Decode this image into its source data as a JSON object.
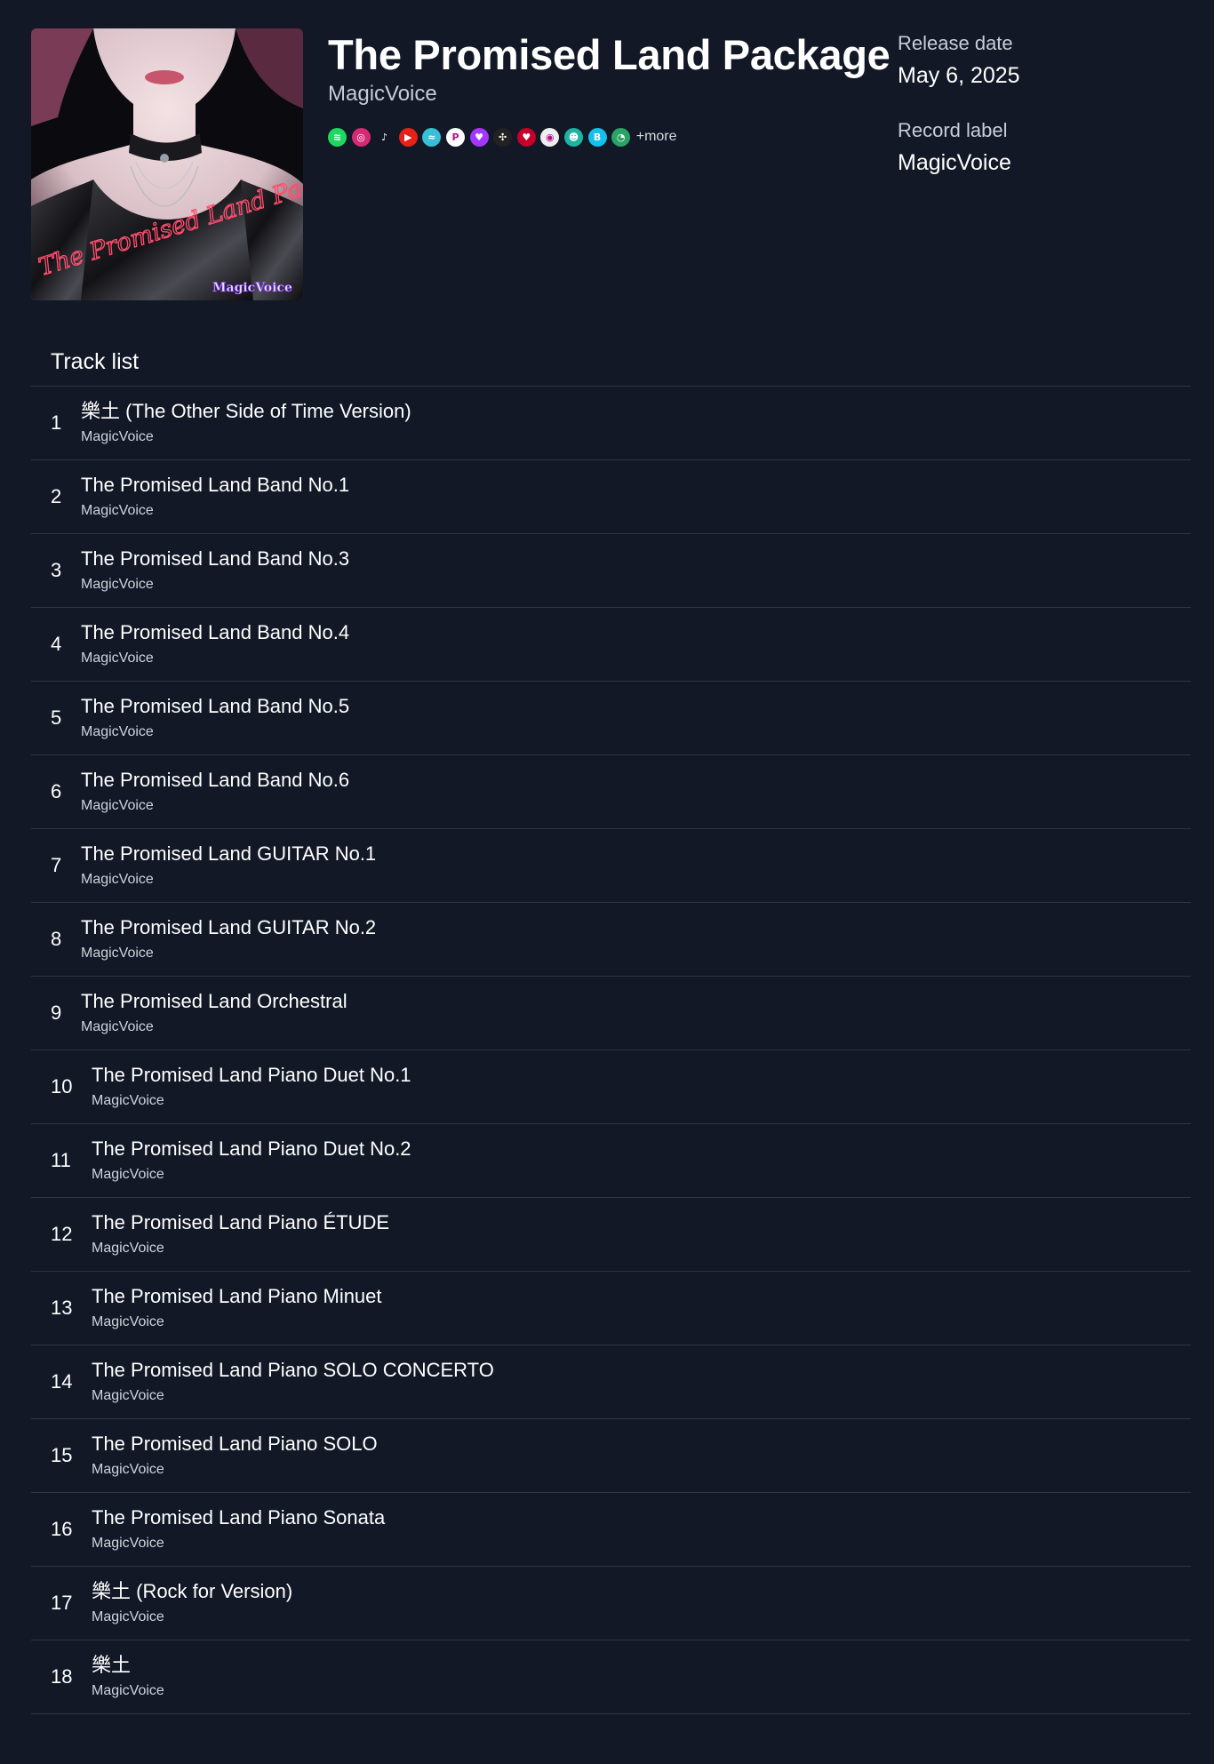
{
  "album": {
    "title": "The Promised Land Package",
    "artist": "MagicVoice",
    "cover_text_main": "The Promised Land Package",
    "cover_text_brand": "MagicVoice"
  },
  "platforms": [
    {
      "icon": "spotify-icon",
      "color": "#1ed760",
      "glyph": "≋"
    },
    {
      "icon": "instagram-icon",
      "color": "#d62976",
      "glyph": "◎"
    },
    {
      "icon": "tiktok-icon",
      "color": "#121826",
      "glyph": "♪"
    },
    {
      "icon": "youtube-music-icon",
      "color": "#e62117",
      "glyph": "▶"
    },
    {
      "icon": "amazon-music-icon",
      "color": "#38c0d8",
      "glyph": "≈"
    },
    {
      "icon": "pandora-icon",
      "color": "#ffffff",
      "glyph": "P"
    },
    {
      "icon": "deezer-icon",
      "color": "#a238ff",
      "glyph": "♥"
    },
    {
      "icon": "tidal-icon",
      "color": "#222222",
      "glyph": "✣"
    },
    {
      "icon": "iheartradio-icon",
      "color": "#c6002b",
      "glyph": "♥"
    },
    {
      "icon": "audiomack-icon",
      "color": "#eeeeee",
      "glyph": "◉"
    },
    {
      "icon": "anghami-icon",
      "color": "#1db4a4",
      "glyph": "☻"
    },
    {
      "icon": "boomplay-icon",
      "color": "#12c2e9",
      "glyph": "B"
    },
    {
      "icon": "qobuz-icon",
      "color": "#29a366",
      "glyph": "◔"
    }
  ],
  "platforms_more": "+more",
  "meta": {
    "release_label": "Release date",
    "release_value": "May 6, 2025",
    "label_label": "Record label",
    "label_value": "MagicVoice"
  },
  "tracklist": {
    "heading": "Track list",
    "tracks": [
      {
        "num": "1",
        "name": "樂土 (The Other Side of Time Version)",
        "artist": "MagicVoice"
      },
      {
        "num": "2",
        "name": "The Promised Land Band No.1",
        "artist": "MagicVoice"
      },
      {
        "num": "3",
        "name": "The Promised Land Band No.3",
        "artist": "MagicVoice"
      },
      {
        "num": "4",
        "name": "The Promised Land Band No.4",
        "artist": "MagicVoice"
      },
      {
        "num": "5",
        "name": "The Promised Land Band No.5",
        "artist": "MagicVoice"
      },
      {
        "num": "6",
        "name": "The Promised Land Band No.6",
        "artist": "MagicVoice"
      },
      {
        "num": "7",
        "name": "The Promised Land GUITAR No.1",
        "artist": "MagicVoice"
      },
      {
        "num": "8",
        "name": "The Promised Land GUITAR No.2",
        "artist": "MagicVoice"
      },
      {
        "num": "9",
        "name": "The Promised Land Orchestral",
        "artist": "MagicVoice"
      },
      {
        "num": "10",
        "name": "The Promised Land Piano Duet No.1",
        "artist": "MagicVoice"
      },
      {
        "num": "11",
        "name": "The Promised Land Piano Duet No.2",
        "artist": "MagicVoice"
      },
      {
        "num": "12",
        "name": "The Promised Land Piano ÉTUDE",
        "artist": "MagicVoice"
      },
      {
        "num": "13",
        "name": "The Promised Land Piano Minuet",
        "artist": "MagicVoice"
      },
      {
        "num": "14",
        "name": "The Promised Land Piano SOLO CONCERTO",
        "artist": "MagicVoice"
      },
      {
        "num": "15",
        "name": "The Promised Land Piano SOLO",
        "artist": "MagicVoice"
      },
      {
        "num": "16",
        "name": "The Promised Land Piano Sonata",
        "artist": "MagicVoice"
      },
      {
        "num": "17",
        "name": "樂土 (Rock for Version)",
        "artist": "MagicVoice"
      },
      {
        "num": "18",
        "name": "樂土",
        "artist": "MagicVoice"
      }
    ]
  }
}
